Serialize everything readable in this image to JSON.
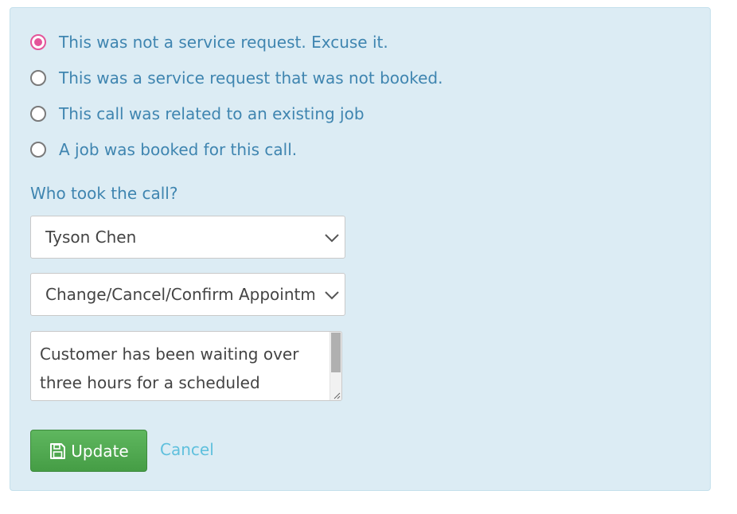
{
  "call_outcome": {
    "options": [
      {
        "label": "This was not a service request. Excuse it.",
        "checked": true
      },
      {
        "label": "This was a service request that was not booked.",
        "checked": false
      },
      {
        "label": "This call was related to an existing job",
        "checked": false
      },
      {
        "label": "A job was booked for this call.",
        "checked": false
      }
    ]
  },
  "call_taker": {
    "question": "Who took the call?",
    "selected": "Tyson Chen"
  },
  "reason": {
    "selected": "Change/Cancel/Confirm Appointment"
  },
  "notes": {
    "value": "Customer has been waiting over three hours for a scheduled"
  },
  "actions": {
    "update_label": "Update",
    "cancel_label": "Cancel"
  },
  "colors": {
    "panel_bg": "#dcecf4",
    "label_text": "#3f85b0",
    "radio_checked": "#e4559a",
    "update_button": "#4cae4c",
    "cancel_link": "#5fc0dd"
  },
  "icons": {
    "select_arrow": "chevron-down-icon",
    "update": "floppy-disk-icon"
  }
}
